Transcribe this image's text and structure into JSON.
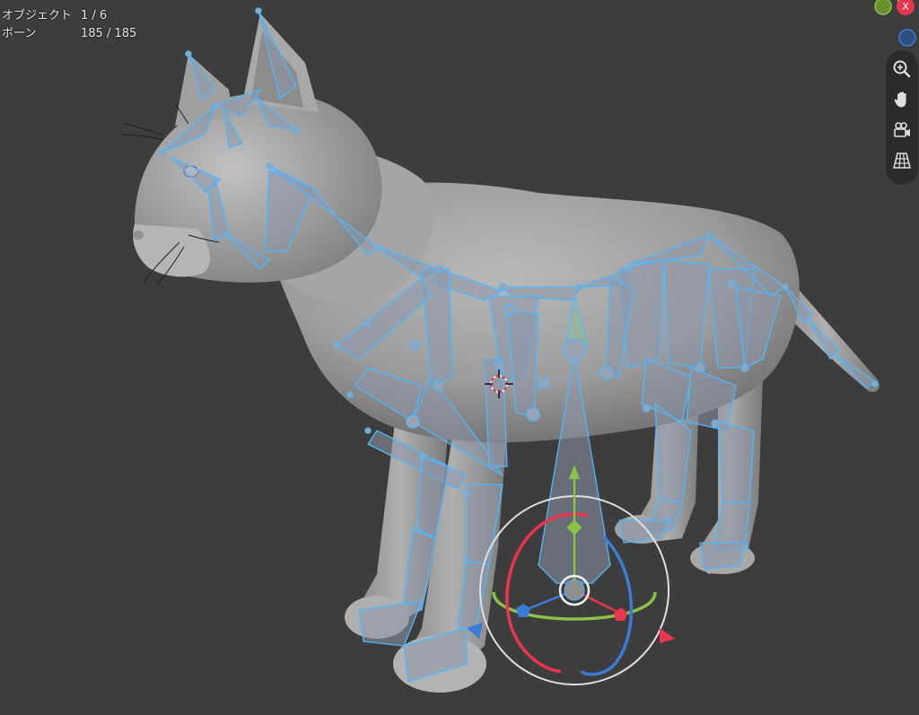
{
  "stats": {
    "objects_label": "オブジェクト",
    "objects_value": "1 / 6",
    "bones_label": "ボーン",
    "bones_value": "185 / 185"
  },
  "gizmo": {
    "x_axis_label": "X",
    "colors": {
      "x": "#e8364f",
      "y": "#8bc34a",
      "z": "#3d7bd6",
      "bone_outline": "#4fb8ff",
      "mesh": "#9a9a9a",
      "background": "#3d3d3d"
    }
  },
  "tools": [
    {
      "name": "zoom",
      "icon": "zoom-icon"
    },
    {
      "name": "pan",
      "icon": "hand-icon"
    },
    {
      "name": "camera",
      "icon": "camera-icon"
    },
    {
      "name": "grid",
      "icon": "perspective-grid-icon"
    }
  ]
}
